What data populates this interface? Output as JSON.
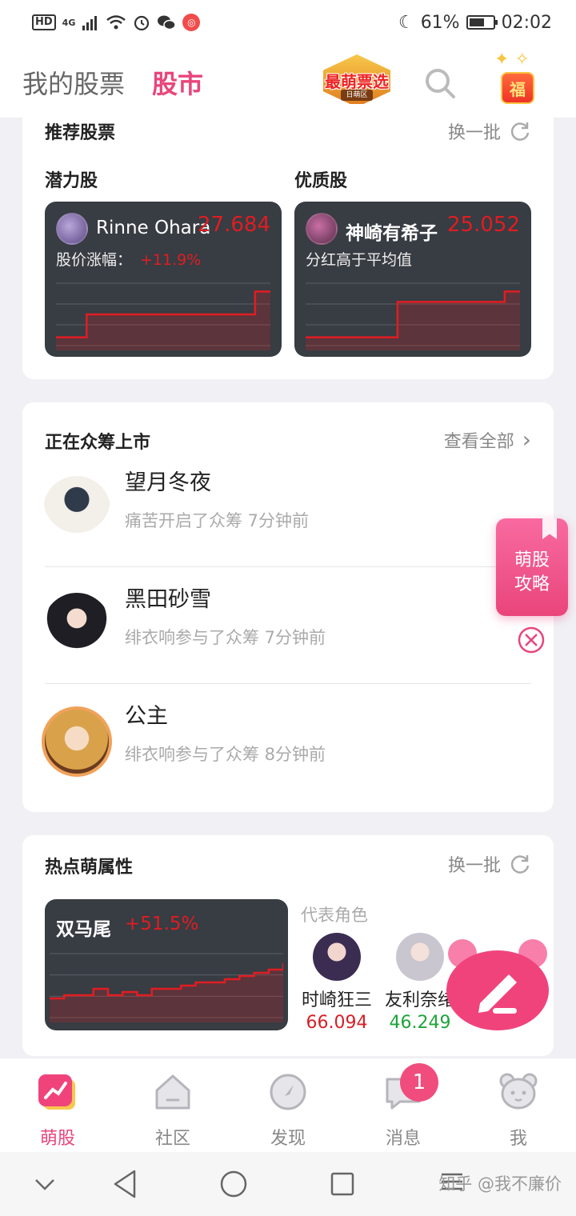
{
  "status": {
    "hd": "HD",
    "network": "4G",
    "battery": "61%",
    "time": "02:02"
  },
  "header": {
    "tabs": [
      {
        "label": "我的股票"
      },
      {
        "label": "股市"
      }
    ],
    "logo": {
      "text": "最萌票选",
      "sub": "日萌区"
    },
    "gift_char": "福"
  },
  "recommend": {
    "title": "推荐股票",
    "refresh_label": "换一批",
    "potential": {
      "heading": "潜力股",
      "name": "Rinne Ohara",
      "price": "27.684",
      "info_label": "股价涨幅：",
      "change": "+11.9%",
      "series": [
        1,
        1,
        2.1,
        2.1,
        2.1,
        2.1,
        2.1,
        2.1,
        2.1,
        2.1,
        2.1,
        2.1,
        2.1,
        3.2,
        3.2
      ]
    },
    "quality": {
      "heading": "优质股",
      "name": "神崎有希子",
      "price": "25.052",
      "info": "分红高于平均值",
      "series": [
        1,
        1,
        1,
        1,
        1,
        1,
        2.7,
        2.7,
        2.7,
        2.7,
        2.7,
        2.7,
        2.7,
        3.2,
        3.2
      ]
    }
  },
  "crowdfunding": {
    "title": "正在众筹上市",
    "view_all": "查看全部",
    "items": [
      {
        "name": "望月冬夜",
        "desc": "痛苦开启了众筹   7分钟前"
      },
      {
        "name": "黑田砂雪",
        "desc": "绯衣响参与了众筹   7分钟前"
      },
      {
        "name": "公主",
        "desc": "绯衣响参与了众筹   8分钟前"
      }
    ]
  },
  "hot": {
    "title": "热点萌属性",
    "refresh_label": "换一批",
    "attribute": {
      "name": "双马尾",
      "change": "+51.5%",
      "series": [
        1.2,
        1.3,
        1.3,
        1.5,
        1.3,
        1.4,
        1.3,
        1.5,
        1.5,
        1.6,
        1.7,
        1.7,
        1.8,
        1.9,
        2.0,
        2.1,
        2.3
      ]
    },
    "rep_label": "代表角色",
    "reps": [
      {
        "name": "时崎狂三",
        "value": "66.094",
        "color": "#d71f26"
      },
      {
        "name": "友利奈绪",
        "value": "46.249",
        "color": "#1fa43a"
      }
    ]
  },
  "float_guide": {
    "line1": "萌股",
    "line2": "攻略"
  },
  "nav": {
    "items": [
      {
        "label": "萌股"
      },
      {
        "label": "社区"
      },
      {
        "label": "发现"
      },
      {
        "label": "消息"
      },
      {
        "label": "我"
      }
    ],
    "badge": "1"
  },
  "watermark": "知乎 @我不廉价",
  "colors": {
    "accent": "#e9457b",
    "up": "#e01d22",
    "down": "#1fa43a"
  }
}
